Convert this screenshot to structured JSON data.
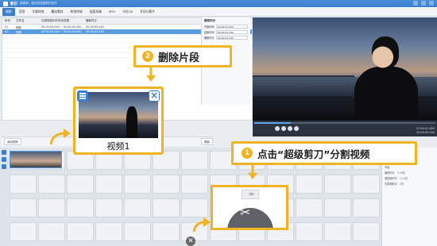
{
  "window": {
    "app_name": "影忆",
    "subtitle": "超简单、强大的视频制作软件"
  },
  "menu": {
    "tabs": [
      "视频",
      "音频",
      "字幕特效",
      "叠加素材",
      "转场特效",
      "画面风格",
      "MTV",
      "卡拉OK",
      "开场与影片"
    ]
  },
  "clip_table": {
    "headers": [
      "序号",
      "文件名",
      "在源视频中的时间范围",
      "截取时长"
    ],
    "rows": [
      {
        "idx": "01",
        "name": "视频",
        "range": "00:00:00.000 ~ 00:00:05.040",
        "dur": "00:00:05.040",
        "selected": false
      },
      {
        "idx": "02",
        "name": "视频",
        "range": "00:00:00.000 ~ 00:00:05.040",
        "dur": "00:00:05.040",
        "selected": true
      }
    ]
  },
  "settings": {
    "title": "截取时长",
    "start_label": "开始时间",
    "start_value": "00:00:01.600",
    "end_label": "结束时间",
    "end_value": "00:00:05.040",
    "dur_label": "截取时长",
    "dur_value": "00:00:03.440"
  },
  "player": {
    "time_current": "00:00:01.600",
    "time_total": "00:00:05.040",
    "progress": 0.2
  },
  "timeline_toolbar": {
    "add_button": "添加视频",
    "delete_button": "删除"
  },
  "property_panel": {
    "rows": [
      {
        "k": "开始",
        "v": ""
      },
      {
        "k": "播放时长",
        "v": "5.04秒"
      },
      {
        "k": "源视频时长",
        "v": "5.04秒"
      },
      {
        "k": "在源视频中",
        "v": "0秒"
      }
    ]
  },
  "callout_delete": {
    "number": "2",
    "label": "删除片段"
  },
  "clip_card": {
    "caption": "视频1"
  },
  "callout_split": {
    "number": "1",
    "label": "点击“超级剪刀”分割视频"
  },
  "scissor": {
    "chevrons": "»»"
  },
  "colors": {
    "accent": "#3a7fcf",
    "highlight": "#f0b323"
  }
}
